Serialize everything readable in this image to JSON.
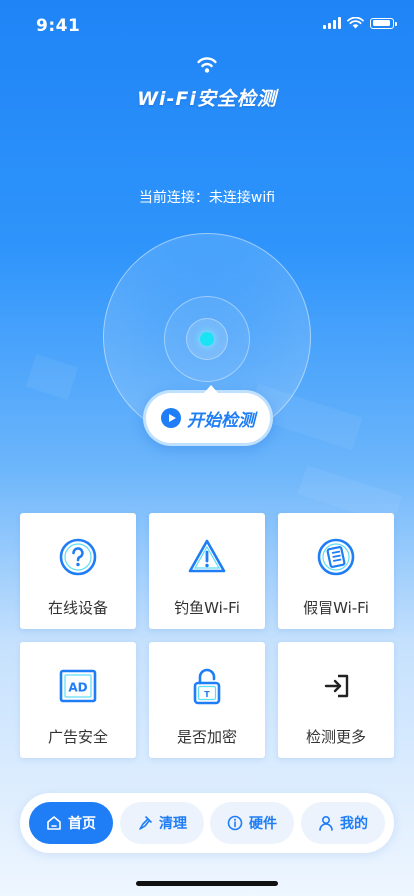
{
  "status_bar": {
    "time": "9:41"
  },
  "header": {
    "title": "Wi-Fi安全检测"
  },
  "connection": {
    "text": "当前连接：未连接wifi"
  },
  "scan": {
    "start_label": "开始检测"
  },
  "features": [
    {
      "label": "在线设备",
      "icon": "question-circle-icon"
    },
    {
      "label": "钓鱼Wi-Fi",
      "icon": "warning-triangle-icon"
    },
    {
      "label": "假冒Wi-Fi",
      "icon": "document-circle-icon"
    },
    {
      "label": "广告安全",
      "icon": "ad-box-icon"
    },
    {
      "label": "是否加密",
      "icon": "unlock-icon"
    },
    {
      "label": "检测更多",
      "icon": "enter-arrow-icon"
    }
  ],
  "tabs": [
    {
      "label": "首页",
      "icon": "home-icon",
      "active": true
    },
    {
      "label": "清理",
      "icon": "brush-icon",
      "active": false
    },
    {
      "label": "硬件",
      "icon": "info-icon",
      "active": false
    },
    {
      "label": "我的",
      "icon": "user-icon",
      "active": false
    }
  ],
  "colors": {
    "primary": "#1f7df5",
    "accent": "#19e3f4",
    "background_top": "#1f84f6"
  }
}
